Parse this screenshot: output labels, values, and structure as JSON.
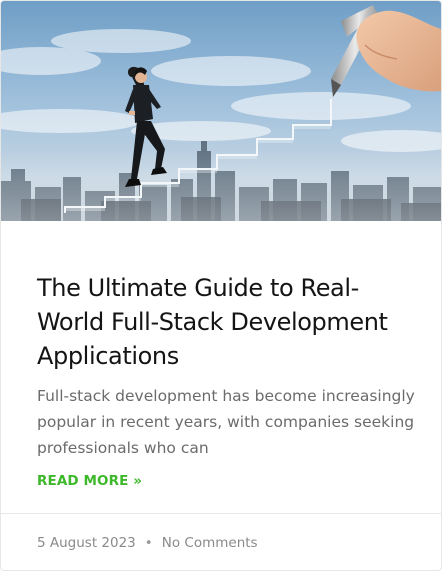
{
  "post": {
    "title": "The Ultimate Guide to Real-World Full-Stack Development Applications",
    "excerpt": "Full-stack development has become increasingly popular in recent years, with companies seeking professionals who can",
    "read_more_label": "READ MORE »",
    "date": "5 August 2023",
    "separator": "•",
    "comments_label": "No Comments",
    "accent_color": "#3db82a"
  }
}
